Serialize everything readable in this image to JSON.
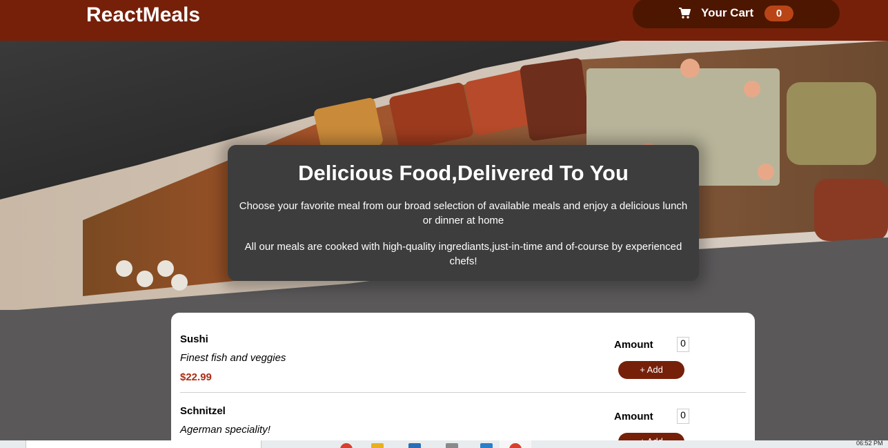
{
  "header": {
    "brand": "ReactMeals",
    "cart": {
      "label": "Your Cart",
      "count": "0"
    }
  },
  "summary": {
    "title": "Delicious Food,Delivered To You",
    "paragraph1": "Choose your favorite meal from our broad selection of available meals and enjoy a delicious lunch or dinner at home",
    "paragraph2": "All our meals are cooked with high-quality ingrediants,just-in-time and of-course by experienced chefs!"
  },
  "meals": [
    {
      "name": "Sushi",
      "description": "Finest fish and veggies",
      "price": "$22.99",
      "amount_label": "Amount",
      "amount_value": "0",
      "add_label": "+ Add"
    },
    {
      "name": "Schnitzel",
      "description": "Agerman speciality!",
      "amount_label": "Amount",
      "amount_value": "0",
      "add_label": "+ Add"
    }
  ],
  "taskbar": {
    "clock": "06:52 PM"
  },
  "colors": {
    "header": "#76200a",
    "cart_button": "#4d1601",
    "cart_badge": "#b94517",
    "price": "#ad2d12",
    "add_button": "#76200a",
    "summary_bg": "#3d3d3d",
    "page_bg": "#5a5859"
  },
  "icons": {
    "cart": "shopping-cart-icon"
  }
}
